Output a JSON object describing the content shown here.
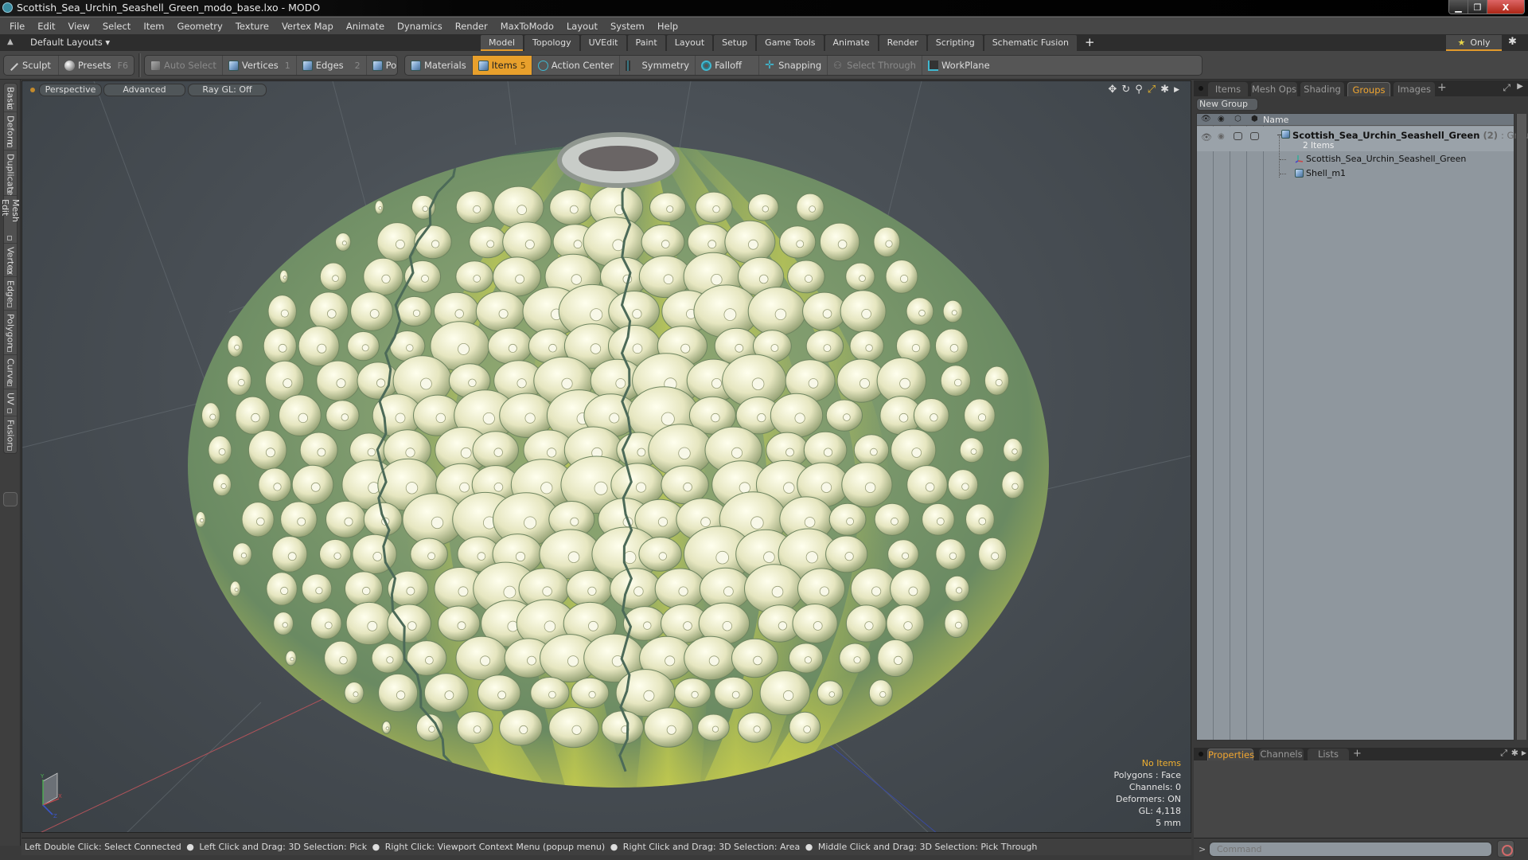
{
  "window": {
    "title": "Scottish_Sea_Urchin_Seashell_Green_modo_base.lxo - MODO",
    "buttons": {
      "minimize": "▁",
      "restore": "❐",
      "close": "X"
    }
  },
  "menu": [
    "File",
    "Edit",
    "View",
    "Select",
    "Item",
    "Geometry",
    "Texture",
    "Vertex Map",
    "Animate",
    "Dynamics",
    "Render",
    "MaxToModo",
    "Layout",
    "System",
    "Help"
  ],
  "layout_bar": {
    "layouts_label": "Default Layouts ▾",
    "tabs": [
      {
        "label": "Model",
        "active": true
      },
      {
        "label": "Topology"
      },
      {
        "label": "UVEdit"
      },
      {
        "label": "Paint"
      },
      {
        "label": "Layout"
      },
      {
        "label": "Setup"
      },
      {
        "label": "Game Tools"
      },
      {
        "label": "Animate"
      },
      {
        "label": "Render"
      },
      {
        "label": "Scripting"
      },
      {
        "label": "Schematic Fusion"
      }
    ],
    "add_tab": "+",
    "only_label": "Only",
    "accent_color": "#e29a2b"
  },
  "toolbar": {
    "sculpt": "Sculpt",
    "presets": "Presets",
    "presets_key": "F6",
    "auto_select": "Auto Select",
    "vertices": "Vertices",
    "vertices_key": "1",
    "edges": "Edges",
    "edges_key": "2",
    "polygons": "Polygons",
    "materials": "Materials",
    "items": "Items",
    "items_key": "5",
    "action_center": "Action Center",
    "symmetry": "Symmetry",
    "falloff": "Falloff",
    "snapping": "Snapping",
    "select_through": "Select Through",
    "workplane": "WorkPlane"
  },
  "left_tabs": [
    "Basic",
    "Deform",
    "Duplicate",
    "Mesh Edit",
    "Vertex",
    "Edge",
    "Polygon",
    "Curve",
    "UV",
    "Fusion"
  ],
  "viewport": {
    "view_mode": "Perspective",
    "shading": "Advanced",
    "raygl": "Ray GL: Off",
    "stats": {
      "selection": "No Items",
      "polygons": "Polygons : Face",
      "channels": "Channels: 0",
      "deformers": "Deformers: ON",
      "gl": "GL: 4,118",
      "unit": "5 mm"
    },
    "axis": {
      "x": "X",
      "y": "Y",
      "z": "Z"
    }
  },
  "status_bar": {
    "hints": [
      "Left Double Click: Select Connected",
      "Left Click and Drag: 3D Selection: Pick",
      "Right Click: Viewport Context Menu (popup menu)",
      "Right Click and Drag: 3D Selection: Area",
      "Middle Click and Drag: 3D Selection: Pick Through"
    ],
    "separator": "●"
  },
  "right_panel": {
    "tabs": [
      {
        "label": "Items"
      },
      {
        "label": "Mesh Ops"
      },
      {
        "label": "Shading"
      },
      {
        "label": "Groups",
        "active": true
      },
      {
        "label": "Images"
      }
    ],
    "add_tab": "+",
    "new_group_label": "New Group",
    "tree": {
      "column_name": "Name",
      "group": {
        "name": "Scottish_Sea_Urchin_Seashell_Green",
        "count": "(2)",
        "type": ": Group",
        "subtitle": "2 Items"
      },
      "children": [
        {
          "name": "Scottish_Sea_Urchin_Seashell_Green",
          "icon": "locator-icon"
        },
        {
          "name": "Shell_m1",
          "icon": "mesh-icon"
        }
      ]
    }
  },
  "bottom_panel": {
    "tabs": [
      {
        "label": "Properties",
        "active": true
      },
      {
        "label": "Channels"
      },
      {
        "label": "Lists"
      }
    ],
    "add_tab": "+",
    "command_placeholder": "Command",
    "prompt": ">"
  }
}
